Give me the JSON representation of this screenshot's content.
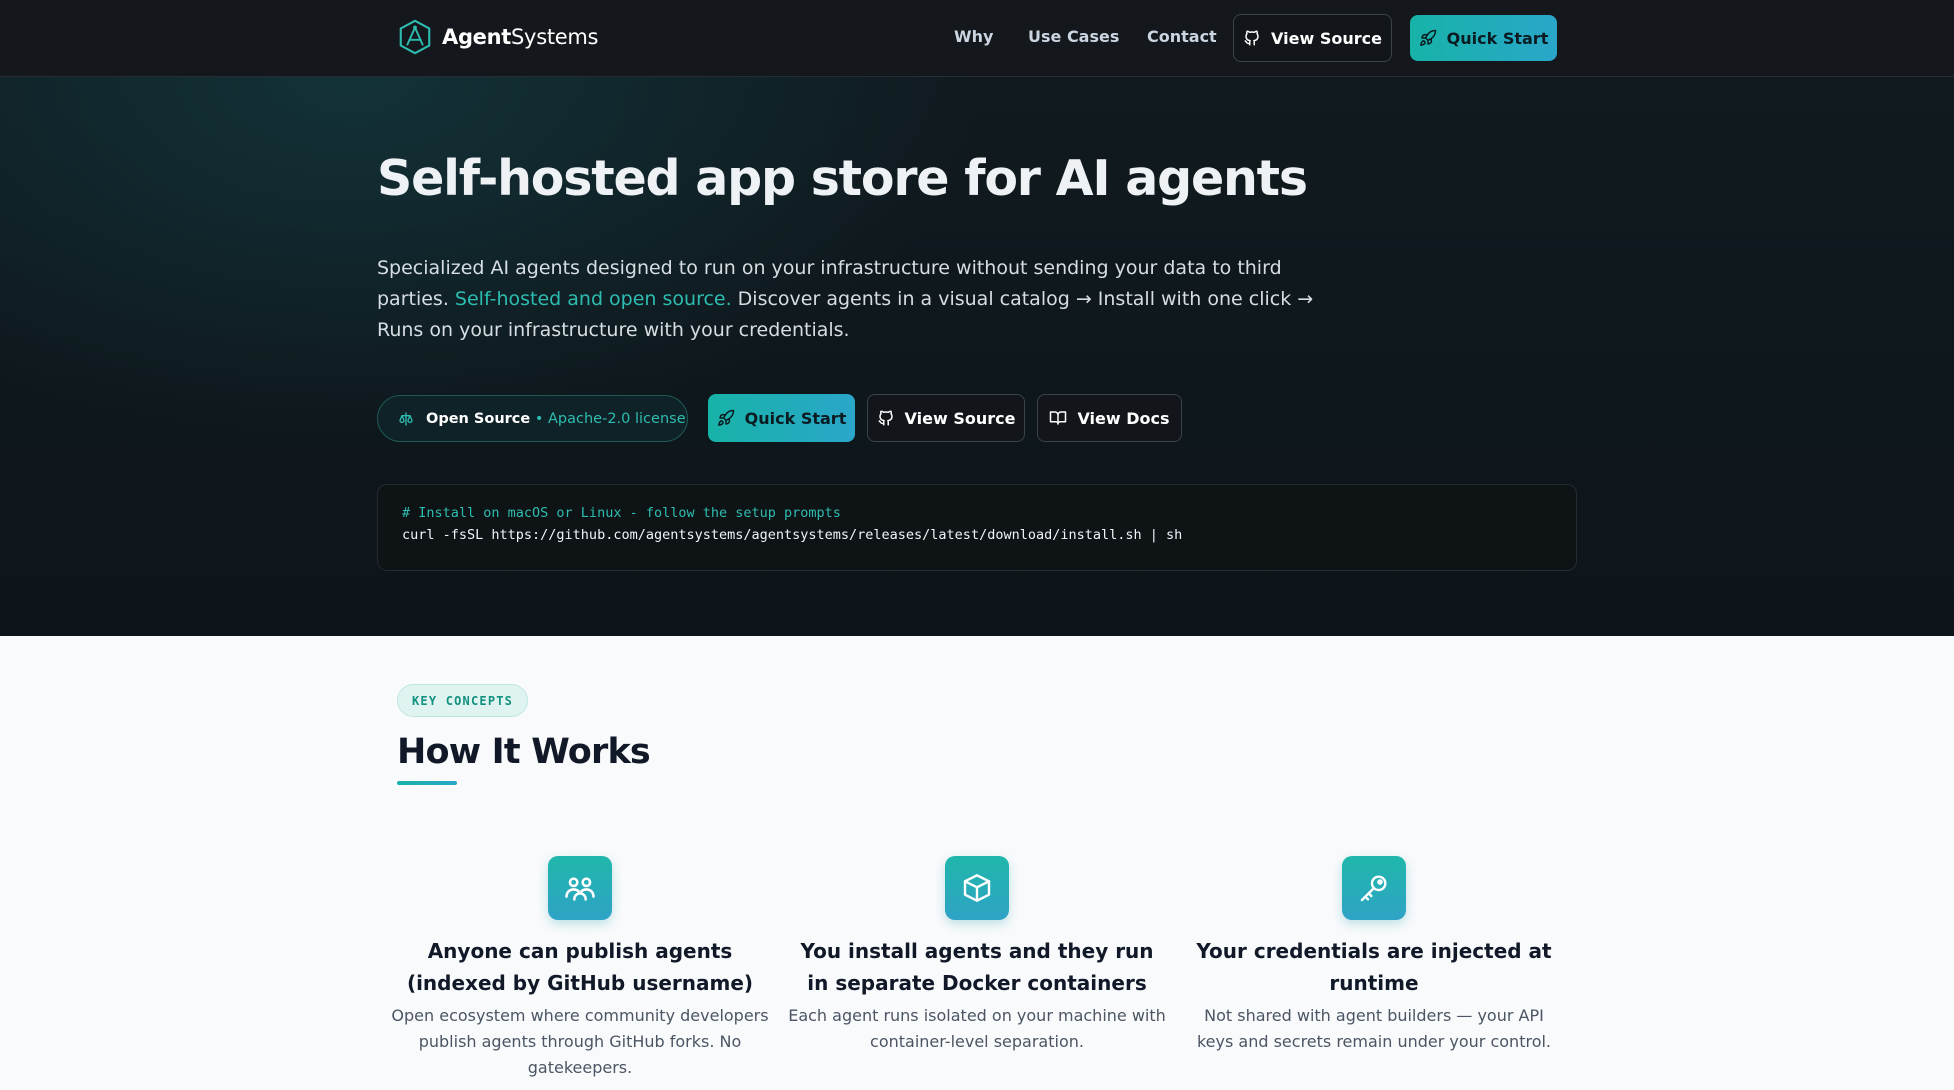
{
  "nav": {
    "brand_bold": "Agent",
    "brand_light": "Systems",
    "links": [
      "Why",
      "Use Cases",
      "Contact"
    ],
    "view_source": "View Source",
    "quick_start": "Quick Start"
  },
  "hero": {
    "title": "Self-hosted app store for AI agents",
    "desc_part1": "Specialized AI agents designed to run on your infrastructure without sending your data to third parties. ",
    "desc_highlight": "Self-hosted and open source.",
    "desc_part2": " Discover agents in a visual catalog → Install with one click → Runs on your infrastructure with your credentials.",
    "pill_label": "Open Source",
    "pill_sep": "•",
    "pill_license": "Apache-2.0 license",
    "quick_start": "Quick Start",
    "view_source": "View Source",
    "view_docs": "View Docs",
    "code_comment": "# Install on macOS or Linux - follow the setup prompts",
    "code_cmd": "curl -fsSL https://github.com/agentsystems/agentsystems/releases/latest/download/install.sh | sh"
  },
  "how": {
    "badge": "KEY CONCEPTS",
    "title": "How It Works",
    "features": [
      {
        "icon": "users-icon",
        "title": "Anyone can publish agents (indexed by GitHub username)",
        "desc": "Open ecosystem where community developers publish agents through GitHub forks. No gatekeepers."
      },
      {
        "icon": "box-icon",
        "title": "You install agents and they run in separate Docker containers",
        "desc": "Each agent runs isolated on your machine with container-level separation."
      },
      {
        "icon": "key-icon",
        "title": "Your credentials are injected at runtime",
        "desc": "Not shared with agent builders — your API keys and secrets remain under your control."
      }
    ]
  },
  "colors": {
    "accent": "#17b3a8",
    "accent_blue": "#2aa6c9",
    "hero_bg": "#0d151a",
    "nav_bg": "#14181c"
  }
}
